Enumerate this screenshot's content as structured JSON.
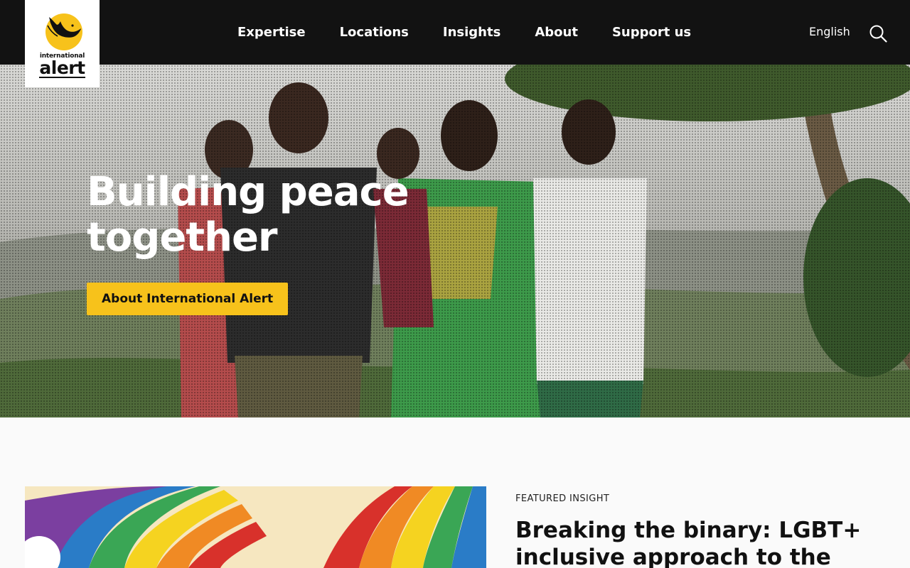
{
  "brand": {
    "logo_small": "international",
    "logo_big": "alert",
    "accent": "#f7c21b",
    "header_bg": "#121212"
  },
  "nav": {
    "items": [
      {
        "label": "Expertise"
      },
      {
        "label": "Locations"
      },
      {
        "label": "Insights"
      },
      {
        "label": "About"
      },
      {
        "label": "Support us"
      }
    ],
    "language": "English",
    "search_icon": "search-icon"
  },
  "hero": {
    "title": "Building peace together",
    "cta_label": "About International Alert"
  },
  "featured": {
    "label": "FEATURED INSIGHT",
    "title": "Breaking the binary: LGBT+ inclusive approach to the"
  }
}
